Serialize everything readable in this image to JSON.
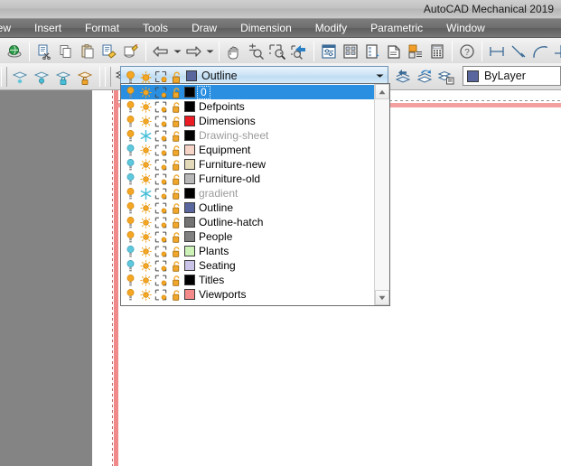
{
  "window": {
    "app_title": "AutoCAD Mechanical 2019"
  },
  "menubar": {
    "items": [
      {
        "label": "iew"
      },
      {
        "label": "Insert"
      },
      {
        "label": "Format"
      },
      {
        "label": "Tools"
      },
      {
        "label": "Draw"
      },
      {
        "label": "Dimension"
      },
      {
        "label": "Modify"
      },
      {
        "label": "Parametric"
      },
      {
        "label": "Window"
      }
    ]
  },
  "toolbar_row1": {
    "buttons": [
      {
        "name": "globe-icon"
      },
      {
        "name": "cut-icon"
      },
      {
        "name": "copy-icon"
      },
      {
        "name": "paste-icon"
      },
      {
        "name": "match-properties-icon"
      },
      {
        "name": "edit-block-icon"
      },
      {
        "name": "undo-icon"
      },
      {
        "name": "undo-dropdown-arrow-icon"
      },
      {
        "name": "redo-icon"
      },
      {
        "name": "redo-dropdown-arrow-icon"
      },
      {
        "name": "pan-icon"
      },
      {
        "name": "zoom-realtime-icon"
      },
      {
        "name": "zoom-window-icon"
      },
      {
        "name": "zoom-previous-icon"
      },
      {
        "name": "properties-icon"
      },
      {
        "name": "design-center-icon"
      },
      {
        "name": "tool-palettes-icon"
      },
      {
        "name": "sheet-set-manager-icon"
      },
      {
        "name": "markup-set-manager-icon"
      },
      {
        "name": "quick-calc-icon"
      },
      {
        "name": "help-icon"
      },
      {
        "name": "linear-dimension-icon"
      },
      {
        "name": "aligned-dimension-icon"
      },
      {
        "name": "arc-length-dimension-icon"
      },
      {
        "name": "ordinate-dimension-icon"
      },
      {
        "name": "radius-dimension-icon"
      }
    ]
  },
  "toolbar_row2": {
    "buttons": [
      {
        "name": "layer-freeze-icon"
      },
      {
        "name": "layer-off-icon"
      },
      {
        "name": "layer-lock-icon"
      },
      {
        "name": "layer-unlock-icon"
      },
      {
        "name": "layer-properties-manager-icon"
      },
      {
        "name": "layer-previous-icon"
      },
      {
        "name": "layer-make-current-icon"
      },
      {
        "name": "layer-states-icon"
      }
    ]
  },
  "layer_combo": {
    "current_layer": "Outline",
    "swatch_color": "#59679e",
    "icons": [
      "lightbulb-on-icon",
      "sun-thaw-icon",
      "viewport-freeze-icon",
      "unlock-icon"
    ],
    "dropdown_arrow": "chevron-down-icon",
    "expanded": true
  },
  "bylayer_combo": {
    "value": "ByLayer",
    "swatch_color": "#59679e"
  },
  "layer_list": {
    "scrollbar": {
      "up_arrow": "scroll-up-icon",
      "down_arrow": "scroll-down-icon"
    },
    "rows": [
      {
        "name": "0",
        "color": "#000000",
        "selected": true,
        "frozen": false
      },
      {
        "name": "Defpoints",
        "color": "#000000",
        "selected": false,
        "frozen": false
      },
      {
        "name": "Dimensions",
        "color": "#ec1c24",
        "selected": false,
        "frozen": false
      },
      {
        "name": "Drawing-sheet",
        "color": "#000000",
        "selected": false,
        "frozen": true
      },
      {
        "name": "Equipment",
        "color": "#f7d4c8",
        "selected": false,
        "frozen": false
      },
      {
        "name": "Furniture-new",
        "color": "#e2dab8",
        "selected": false,
        "frozen": false
      },
      {
        "name": "Furniture-old",
        "color": "#b8b8b8",
        "selected": false,
        "frozen": false
      },
      {
        "name": "gradient",
        "color": "#000000",
        "selected": false,
        "frozen": true
      },
      {
        "name": "Outline",
        "color": "#59679e",
        "selected": false,
        "frozen": false
      },
      {
        "name": "Outline-hatch",
        "color": "#737373",
        "selected": false,
        "frozen": false
      },
      {
        "name": "People",
        "color": "#808080",
        "selected": false,
        "frozen": false
      },
      {
        "name": "Plants",
        "color": "#ccf2b8",
        "selected": false,
        "frozen": false
      },
      {
        "name": "Seating",
        "color": "#c9c4e8",
        "selected": false,
        "frozen": false
      },
      {
        "name": "Titles",
        "color": "#000000",
        "selected": false,
        "frozen": false
      },
      {
        "name": "Viewports",
        "color": "#f58a8a",
        "selected": false,
        "frozen": false
      }
    ]
  },
  "canvas": {
    "guide_line_color": "#f08a8a",
    "panel_color": "#848484"
  }
}
